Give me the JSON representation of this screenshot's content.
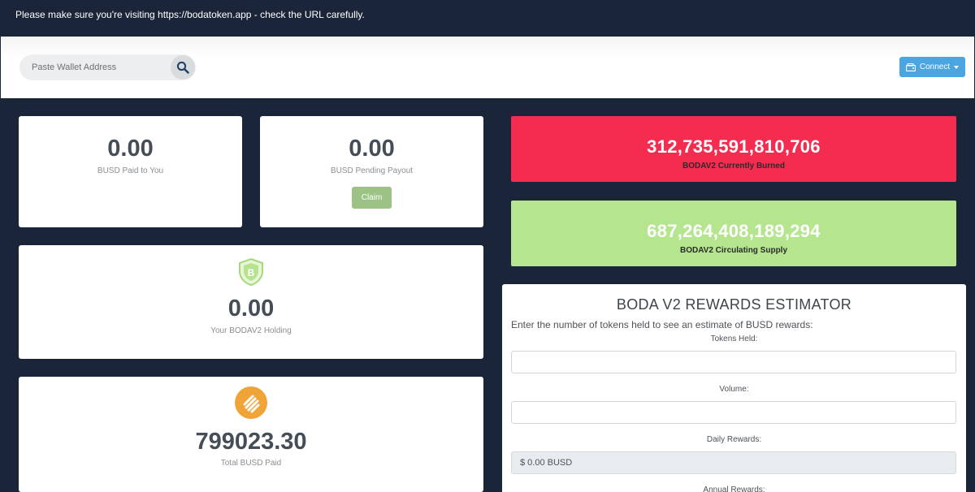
{
  "banner": {
    "text": "Please make sure you're visiting https://bodatoken.app - check the URL carefully."
  },
  "header": {
    "search_placeholder": "Paste Wallet Address",
    "connect_label": "Connect"
  },
  "cards": {
    "busd_paid": {
      "value": "0.00",
      "label": "BUSD Paid to You"
    },
    "busd_pending": {
      "value": "0.00",
      "label": "BUSD Pending Payout",
      "claim_label": "Claim"
    },
    "holding": {
      "value": "0.00",
      "label": "Your BODAV2 Holding"
    },
    "total_paid": {
      "value": "799023.30",
      "label": "Total BUSD Paid"
    }
  },
  "stats": {
    "burned": {
      "value": "312,735,591,810,706",
      "label": "BODAV2 Currently Burned",
      "color": "#f42c50"
    },
    "supply": {
      "value": "687,264,408,189,294",
      "label": "BODAV2 Circulating Supply",
      "color": "#b5e68f"
    }
  },
  "estimator": {
    "title": "BODA V2 REWARDS ESTIMATOR",
    "description": "Enter the number of tokens held to see an estimate of BUSD rewards:",
    "tokens_label": "Tokens Held:",
    "tokens_value": "",
    "volume_label": "Volume:",
    "volume_value": "",
    "daily_label": "Daily Rewards:",
    "daily_value": "$ 0.00 BUSD",
    "annual_label": "Annual Rewards:"
  },
  "icons": {
    "search": "search-icon",
    "wallet": "wallet-icon",
    "caret": "caret-down-icon",
    "boda_logo": "boda-shield-logo",
    "busd_logo": "busd-coin-logo"
  }
}
